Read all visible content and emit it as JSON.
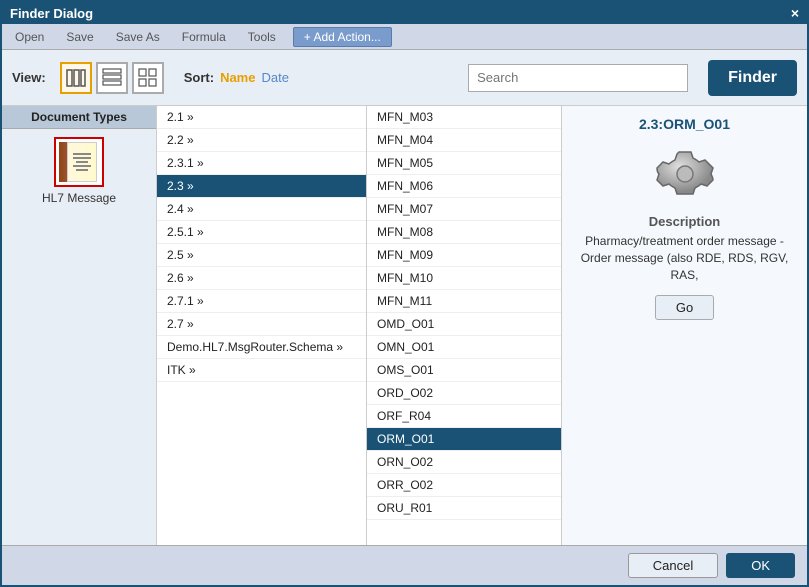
{
  "window": {
    "title": "Finder Dialog",
    "close_label": "×"
  },
  "menubar": {
    "items": [
      {
        "id": "open",
        "label": "Open",
        "disabled": false
      },
      {
        "id": "save",
        "label": "Save",
        "disabled": false
      },
      {
        "id": "save-as",
        "label": "Save As",
        "disabled": false
      },
      {
        "id": "formula",
        "label": "Formula",
        "disabled": false
      },
      {
        "id": "tools",
        "label": "Tools",
        "disabled": false
      },
      {
        "id": "add-action",
        "label": "+ Add Action...",
        "disabled": false
      }
    ]
  },
  "toolbar": {
    "view_label": "View:",
    "sort_label": "Sort:",
    "sort_name": "Name",
    "sort_date": "Date",
    "search_placeholder": "Search",
    "finder_label": "Finder"
  },
  "doc_types_panel": {
    "header": "Document Types",
    "items": [
      {
        "id": "hl7",
        "label": "HL7 Message"
      }
    ]
  },
  "tree_panel": {
    "items": [
      {
        "id": "2.1",
        "label": "2.1 »",
        "selected": false
      },
      {
        "id": "2.2",
        "label": "2.2 »",
        "selected": false
      },
      {
        "id": "2.3.1",
        "label": "2.3.1 »",
        "selected": false
      },
      {
        "id": "2.3",
        "label": "2.3 »",
        "selected": true
      },
      {
        "id": "2.4",
        "label": "2.4 »",
        "selected": false
      },
      {
        "id": "2.5.1",
        "label": "2.5.1 »",
        "selected": false
      },
      {
        "id": "2.5",
        "label": "2.5 »",
        "selected": false
      },
      {
        "id": "2.6",
        "label": "2.6 »",
        "selected": false
      },
      {
        "id": "2.7.1",
        "label": "2.7.1 »",
        "selected": false
      },
      {
        "id": "2.7",
        "label": "2.7 »",
        "selected": false
      },
      {
        "id": "demo",
        "label": "Demo.HL7.MsgRouter.Schema »",
        "selected": false
      },
      {
        "id": "itk",
        "label": "ITK »",
        "selected": false
      }
    ]
  },
  "list_panel": {
    "items": [
      {
        "id": "MFN_M03",
        "label": "MFN_M03",
        "selected": false
      },
      {
        "id": "MFN_M04",
        "label": "MFN_M04",
        "selected": false
      },
      {
        "id": "MFN_M05",
        "label": "MFN_M05",
        "selected": false
      },
      {
        "id": "MFN_M06",
        "label": "MFN_M06",
        "selected": false
      },
      {
        "id": "MFN_M07",
        "label": "MFN_M07",
        "selected": false
      },
      {
        "id": "MFN_M08",
        "label": "MFN_M08",
        "selected": false
      },
      {
        "id": "MFN_M09",
        "label": "MFN_M09",
        "selected": false
      },
      {
        "id": "MFN_M10",
        "label": "MFN_M10",
        "selected": false
      },
      {
        "id": "MFN_M11",
        "label": "MFN_M11",
        "selected": false
      },
      {
        "id": "OMD_O01",
        "label": "OMD_O01",
        "selected": false
      },
      {
        "id": "OMN_O01",
        "label": "OMN_O01",
        "selected": false
      },
      {
        "id": "OMS_O01",
        "label": "OMS_O01",
        "selected": false
      },
      {
        "id": "ORD_O02",
        "label": "ORD_O02",
        "selected": false
      },
      {
        "id": "ORF_R04",
        "label": "ORF_R04",
        "selected": false
      },
      {
        "id": "ORM_O01",
        "label": "ORM_O01",
        "selected": true
      },
      {
        "id": "ORN_O02",
        "label": "ORN_O02",
        "selected": false
      },
      {
        "id": "ORR_O02",
        "label": "ORR_O02",
        "selected": false
      },
      {
        "id": "ORU_R01",
        "label": "ORU_R01",
        "selected": false
      }
    ]
  },
  "detail_panel": {
    "title": "2.3:ORM_O01",
    "desc_label": "Description",
    "desc_text": "Pharmacy/treatment order message - Order message (also RDE, RDS, RGV, RAS,",
    "go_label": "Go"
  },
  "bottom_bar": {
    "cancel_label": "Cancel",
    "ok_label": "OK"
  }
}
